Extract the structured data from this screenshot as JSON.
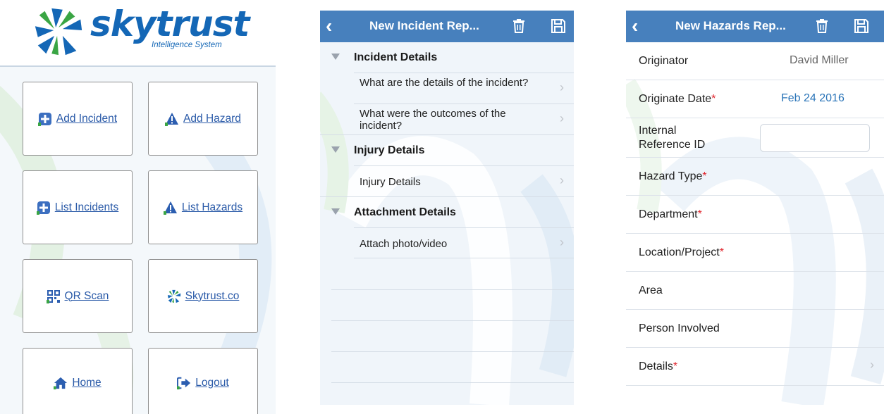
{
  "home": {
    "logo": {
      "word": "skytrust",
      "sub": "Intelligence System"
    },
    "tiles": [
      {
        "label": "Add Incident",
        "icon": "plus-icon"
      },
      {
        "label": "Add Hazard",
        "icon": "warning-icon"
      },
      {
        "label": "List Incidents",
        "icon": "plus-icon"
      },
      {
        "label": "List Hazards",
        "icon": "warning-icon"
      },
      {
        "label": "QR Scan",
        "icon": "qr-code-icon"
      },
      {
        "label": "Skytrust.co",
        "icon": "skytrust-logo-icon"
      },
      {
        "label": "Home",
        "icon": "home-icon"
      },
      {
        "label": "Logout",
        "icon": "logout-icon"
      }
    ]
  },
  "incident": {
    "title": "New Incident Rep...",
    "sections": [
      {
        "title": "Incident Details",
        "rows": [
          "What are the details of the incident?",
          "What were the outcomes of the incident?"
        ]
      },
      {
        "title": "Injury Details",
        "rows": [
          "Injury Details"
        ]
      },
      {
        "title": "Attachment Details",
        "rows": [
          "Attach photo/video"
        ]
      }
    ]
  },
  "hazard": {
    "title": "New Hazards Rep...",
    "fields": [
      {
        "label": "Originator",
        "required": false,
        "value": "David Miller"
      },
      {
        "label": "Originate Date",
        "required": true,
        "value": "Feb 24 2016"
      },
      {
        "label": "Internal Reference ID",
        "required": false,
        "value": ""
      },
      {
        "label": "Hazard Type",
        "required": true,
        "value": ""
      },
      {
        "label": "Department",
        "required": true,
        "value": ""
      },
      {
        "label": "Location/Project",
        "required": true,
        "value": ""
      },
      {
        "label": "Area",
        "required": false,
        "value": ""
      },
      {
        "label": "Person Involved",
        "required": false,
        "value": ""
      },
      {
        "label": "Details",
        "required": true,
        "value": ""
      }
    ],
    "required_marker": "*"
  },
  "colors": {
    "navbar": "#4780bd",
    "brand_blue": "#1467b6",
    "brand_green": "#3aa544",
    "link_blue": "#2a5aa8",
    "date_blue": "#2a74b8",
    "required_red": "#e0262e"
  }
}
